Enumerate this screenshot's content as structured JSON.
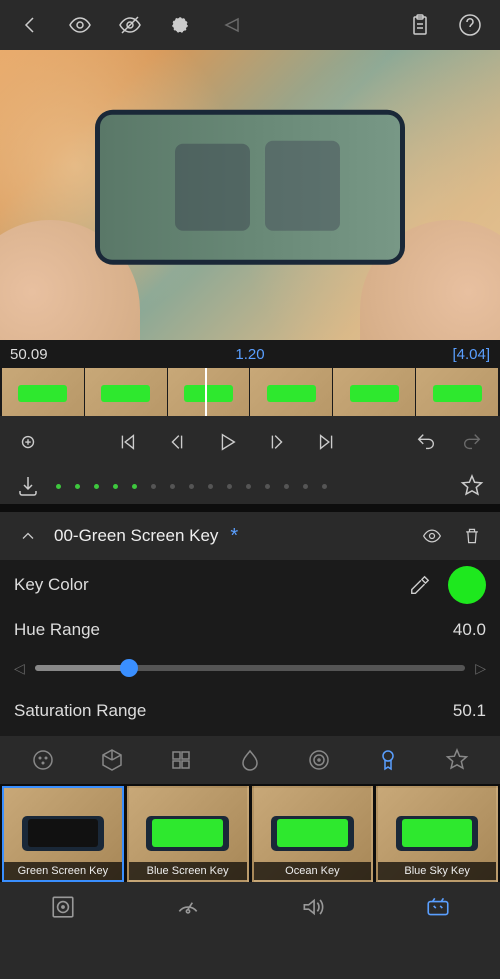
{
  "timecodes": {
    "left": "50.09",
    "center": "1.20",
    "right": "[4.04]"
  },
  "section": {
    "title": "00-Green Screen Key",
    "asterisk": "*"
  },
  "params": {
    "keyColor": {
      "label": "Key Color",
      "color": "#1ee81e"
    },
    "hueRange": {
      "label": "Hue Range",
      "value": "40.0",
      "percent": 22
    },
    "satRange": {
      "label": "Saturation Range",
      "value": "50.1"
    }
  },
  "presets": [
    {
      "label": "Green Screen Key",
      "screen": "#111",
      "selected": true
    },
    {
      "label": "Blue Screen Key",
      "screen": "#2ee82e",
      "selected": false
    },
    {
      "label": "Ocean Key",
      "screen": "#2ee82e",
      "selected": false
    },
    {
      "label": "Blue Sky Key",
      "screen": "#2ee82e",
      "selected": false
    }
  ],
  "progressDots": [
    true,
    true,
    true,
    true,
    true,
    false,
    false,
    false,
    false,
    false,
    false,
    false,
    false,
    false,
    false
  ]
}
